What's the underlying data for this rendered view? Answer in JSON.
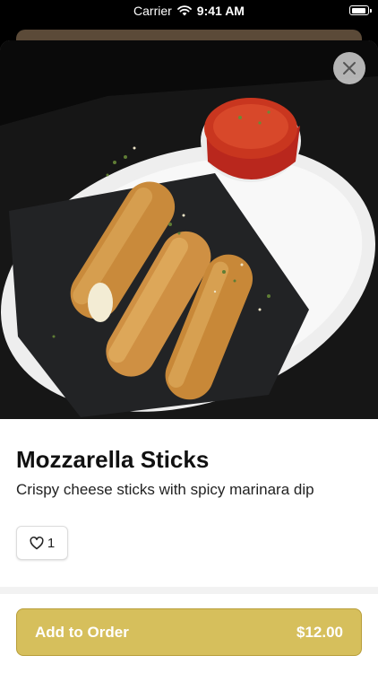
{
  "status_bar": {
    "carrier": "Carrier",
    "time": "9:41 AM"
  },
  "item": {
    "title": "Mozzarella Sticks",
    "description": "Crispy cheese sticks with spicy marinara dip",
    "like_count": "1"
  },
  "order_button": {
    "label": "Add to Order",
    "price": "$12.00"
  },
  "colors": {
    "accent": "#d6bf5c",
    "accent_border": "#b89e3a"
  },
  "icons": [
    "wifi-icon",
    "battery-icon",
    "close-icon",
    "heart-icon"
  ]
}
